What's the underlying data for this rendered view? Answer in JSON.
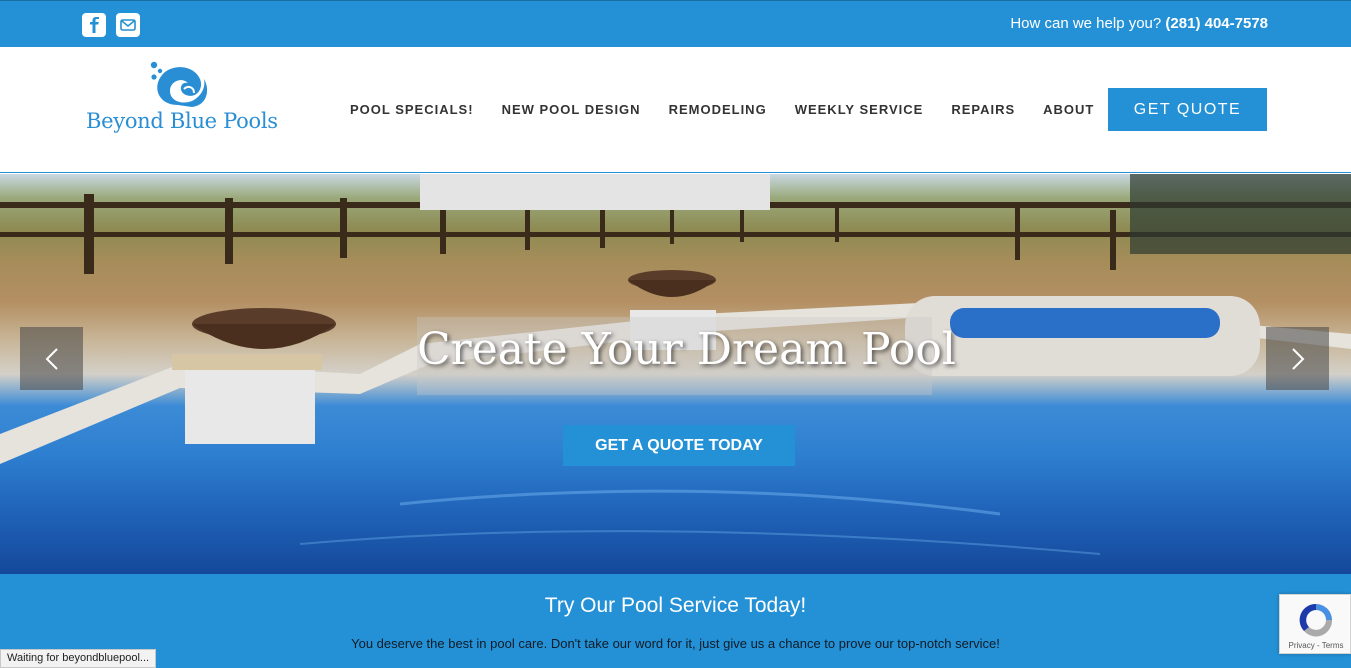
{
  "topbar": {
    "social": [
      "facebook-icon",
      "mail-icon"
    ],
    "help_text": "How can we help you?",
    "phone": "(281) 404-7578"
  },
  "header": {
    "logo_text": "Beyond Blue Pools",
    "nav": [
      {
        "label": "POOL SPECIALS!"
      },
      {
        "label": "NEW POOL DESIGN"
      },
      {
        "label": "REMODELING"
      },
      {
        "label": "WEEKLY SERVICE"
      },
      {
        "label": "REPAIRS"
      },
      {
        "label": "ABOUT"
      }
    ],
    "cta": "GET QUOTE"
  },
  "hero": {
    "title": "Create Your Dream Pool",
    "cta": "GET A QUOTE TODAY",
    "prev_icon": "chevron-left-icon",
    "next_icon": "chevron-right-icon"
  },
  "banner": {
    "title": "Try Our Pool Service Today!",
    "subtitle": "You deserve the best in pool care. Don't take our word for it, just give us a chance to prove our top-notch service!"
  },
  "status_bar": "Waiting for beyondbluepool...",
  "recaptcha": {
    "links": "Privacy - Terms"
  },
  "colors": {
    "accent": "#2491d6",
    "logo": "#2a8ed4",
    "nav_text": "#333333"
  }
}
